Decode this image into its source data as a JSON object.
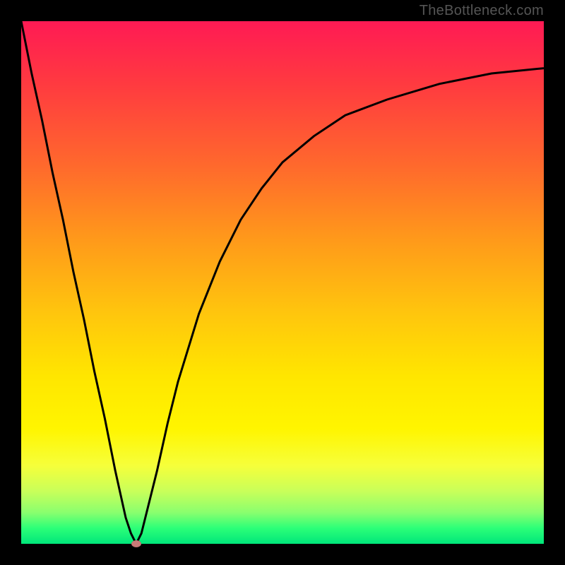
{
  "watermark": "TheBottleneck.com",
  "colors": {
    "frame_border": "#000000",
    "gradient_top": "#ff1a54",
    "gradient_mid1": "#ff9a1a",
    "gradient_mid2": "#ffe600",
    "gradient_bottom": "#00e67a",
    "curve_stroke": "#000000",
    "marker_fill": "#c97a78"
  },
  "chart_data": {
    "type": "line",
    "title": "",
    "xlabel": "",
    "ylabel": "",
    "xlim": [
      0,
      100
    ],
    "ylim": [
      0,
      100
    ],
    "grid": false,
    "legend_position": "none",
    "series": [
      {
        "name": "bottleneck-curve",
        "x": [
          0,
          2,
          4,
          6,
          8,
          10,
          12,
          14,
          16,
          18,
          20,
          21,
          22,
          23,
          24,
          26,
          28,
          30,
          34,
          38,
          42,
          46,
          50,
          56,
          62,
          70,
          80,
          90,
          100
        ],
        "values": [
          100,
          90,
          81,
          71,
          62,
          52,
          43,
          33,
          24,
          14,
          5,
          2,
          0,
          2,
          6,
          14,
          23,
          31,
          44,
          54,
          62,
          68,
          73,
          78,
          82,
          85,
          88,
          90,
          91
        ]
      }
    ],
    "annotations": [
      {
        "name": "marker",
        "x": 22,
        "y": 0
      }
    ]
  }
}
